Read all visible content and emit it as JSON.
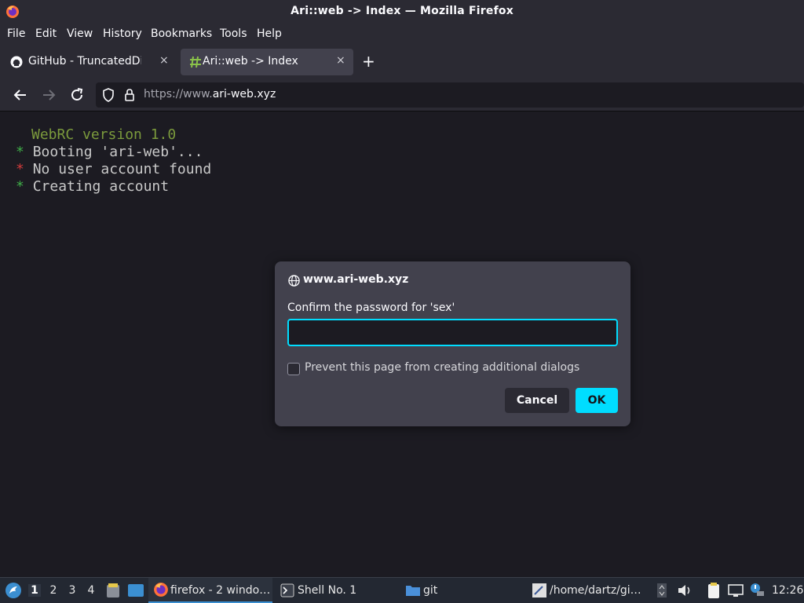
{
  "window": {
    "title": "Ari::web -> Index — Mozilla Firefox"
  },
  "menu": [
    "File",
    "Edit",
    "View",
    "History",
    "Bookmarks",
    "Tools",
    "Help"
  ],
  "tabs": [
    {
      "label": "GitHub - TruncatedDinosour",
      "close": "×",
      "active": false
    },
    {
      "label": "Ari::web -> Index",
      "close": "×",
      "active": true
    }
  ],
  "newtab": "+",
  "url": {
    "prefix": "https://www.",
    "domain": "ari-web.xyz"
  },
  "terminal": {
    "version": "WebRC version 1.0",
    "lines": [
      {
        "star": "*",
        "text": "Booting 'ari-web'..."
      },
      {
        "star": "*",
        "text": "No user account found"
      },
      {
        "star": "*",
        "text": "Creating account"
      }
    ]
  },
  "dialog": {
    "host": "www.ari-web.xyz",
    "prompt": "Confirm the password for 'sex'",
    "password_value": "",
    "checkbox_label": "Prevent this page from creating additional dialogs",
    "cancel": "Cancel",
    "ok": "OK"
  },
  "taskbar": {
    "workspaces": [
      "1",
      "2",
      "3",
      "4"
    ],
    "firefox": "firefox - 2 windo…",
    "shell": "Shell No. 1",
    "git": "git",
    "home": "/home/dartz/gi…",
    "clock": "12:26"
  },
  "colors": {
    "accent": "#00ddff",
    "chrome": "#2b2a33",
    "content": "#1c1b22",
    "dialog": "#42414d"
  }
}
